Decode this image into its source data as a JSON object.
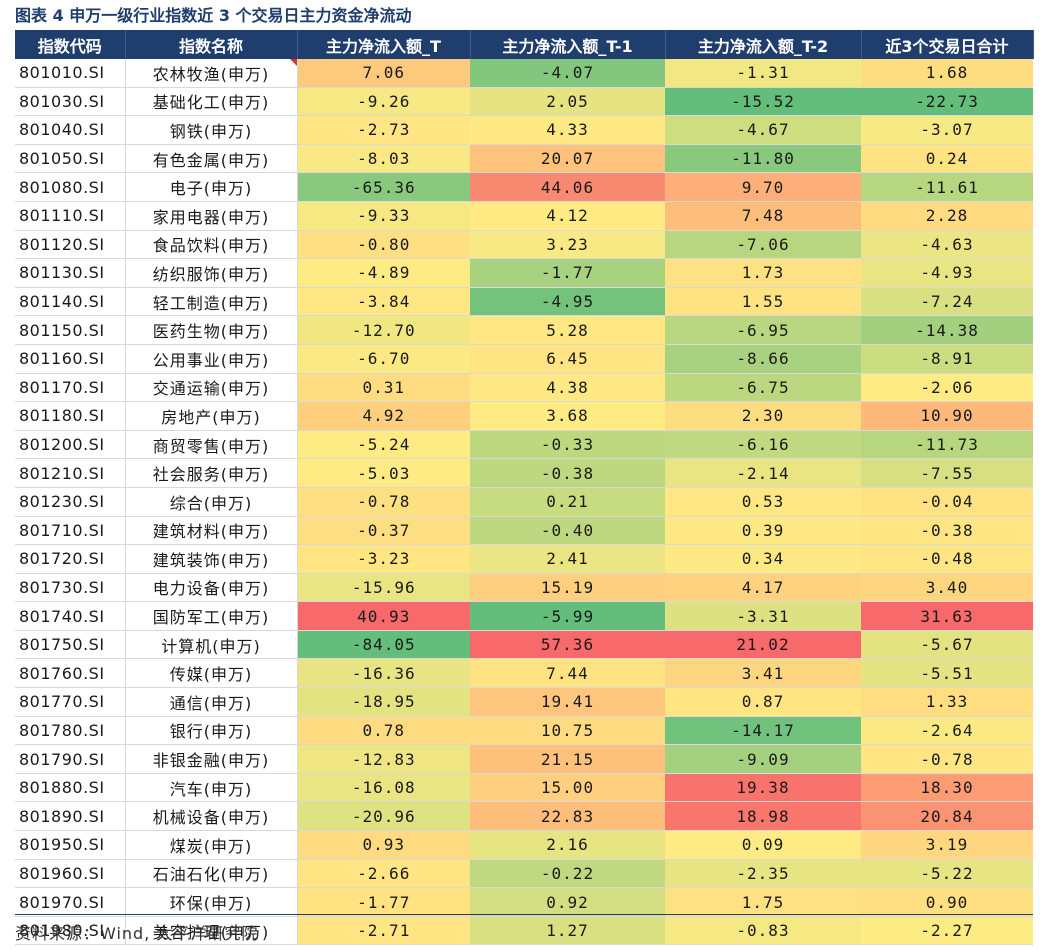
{
  "caption": "图表 4  申万一级行业指数近 3 个交易日主力资金净流动",
  "columns": [
    "指数代码",
    "指数名称",
    "主力净流入额_T",
    "主力净流入额_T-1",
    "主力净流入额_T-2",
    "近3个交易日合计"
  ],
  "rows": [
    {
      "code": "801010.SI",
      "name": "农林牧渔(申万)",
      "t": "7.06",
      "t1": "-4.07",
      "t2": "-1.31",
      "sum": "1.68"
    },
    {
      "code": "801030.SI",
      "name": "基础化工(申万)",
      "t": "-9.26",
      "t1": "2.05",
      "t2": "-15.52",
      "sum": "-22.73"
    },
    {
      "code": "801040.SI",
      "name": "钢铁(申万)",
      "t": "-2.73",
      "t1": "4.33",
      "t2": "-4.67",
      "sum": "-3.07"
    },
    {
      "code": "801050.SI",
      "name": "有色金属(申万)",
      "t": "-8.03",
      "t1": "20.07",
      "t2": "-11.80",
      "sum": "0.24"
    },
    {
      "code": "801080.SI",
      "name": "电子(申万)",
      "t": "-65.36",
      "t1": "44.06",
      "t2": "9.70",
      "sum": "-11.61"
    },
    {
      "code": "801110.SI",
      "name": "家用电器(申万)",
      "t": "-9.33",
      "t1": "4.12",
      "t2": "7.48",
      "sum": "2.28"
    },
    {
      "code": "801120.SI",
      "name": "食品饮料(申万)",
      "t": "-0.80",
      "t1": "3.23",
      "t2": "-7.06",
      "sum": "-4.63"
    },
    {
      "code": "801130.SI",
      "name": "纺织服饰(申万)",
      "t": "-4.89",
      "t1": "-1.77",
      "t2": "1.73",
      "sum": "-4.93"
    },
    {
      "code": "801140.SI",
      "name": "轻工制造(申万)",
      "t": "-3.84",
      "t1": "-4.95",
      "t2": "1.55",
      "sum": "-7.24"
    },
    {
      "code": "801150.SI",
      "name": "医药生物(申万)",
      "t": "-12.70",
      "t1": "5.28",
      "t2": "-6.95",
      "sum": "-14.38"
    },
    {
      "code": "801160.SI",
      "name": "公用事业(申万)",
      "t": "-6.70",
      "t1": "6.45",
      "t2": "-8.66",
      "sum": "-8.91"
    },
    {
      "code": "801170.SI",
      "name": "交通运输(申万)",
      "t": "0.31",
      "t1": "4.38",
      "t2": "-6.75",
      "sum": "-2.06"
    },
    {
      "code": "801180.SI",
      "name": "房地产(申万)",
      "t": "4.92",
      "t1": "3.68",
      "t2": "2.30",
      "sum": "10.90"
    },
    {
      "code": "801200.SI",
      "name": "商贸零售(申万)",
      "t": "-5.24",
      "t1": "-0.33",
      "t2": "-6.16",
      "sum": "-11.73"
    },
    {
      "code": "801210.SI",
      "name": "社会服务(申万)",
      "t": "-5.03",
      "t1": "-0.38",
      "t2": "-2.14",
      "sum": "-7.55"
    },
    {
      "code": "801230.SI",
      "name": "综合(申万)",
      "t": "-0.78",
      "t1": "0.21",
      "t2": "0.53",
      "sum": "-0.04"
    },
    {
      "code": "801710.SI",
      "name": "建筑材料(申万)",
      "t": "-0.37",
      "t1": "-0.40",
      "t2": "0.39",
      "sum": "-0.38"
    },
    {
      "code": "801720.SI",
      "name": "建筑装饰(申万)",
      "t": "-3.23",
      "t1": "2.41",
      "t2": "0.34",
      "sum": "-0.48"
    },
    {
      "code": "801730.SI",
      "name": "电力设备(申万)",
      "t": "-15.96",
      "t1": "15.19",
      "t2": "4.17",
      "sum": "3.40"
    },
    {
      "code": "801740.SI",
      "name": "国防军工(申万)",
      "t": "40.93",
      "t1": "-5.99",
      "t2": "-3.31",
      "sum": "31.63"
    },
    {
      "code": "801750.SI",
      "name": "计算机(申万)",
      "t": "-84.05",
      "t1": "57.36",
      "t2": "21.02",
      "sum": "-5.67"
    },
    {
      "code": "801760.SI",
      "name": "传媒(申万)",
      "t": "-16.36",
      "t1": "7.44",
      "t2": "3.41",
      "sum": "-5.51"
    },
    {
      "code": "801770.SI",
      "name": "通信(申万)",
      "t": "-18.95",
      "t1": "19.41",
      "t2": "0.87",
      "sum": "1.33"
    },
    {
      "code": "801780.SI",
      "name": "银行(申万)",
      "t": "0.78",
      "t1": "10.75",
      "t2": "-14.17",
      "sum": "-2.64"
    },
    {
      "code": "801790.SI",
      "name": "非银金融(申万)",
      "t": "-12.83",
      "t1": "21.15",
      "t2": "-9.09",
      "sum": "-0.78"
    },
    {
      "code": "801880.SI",
      "name": "汽车(申万)",
      "t": "-16.08",
      "t1": "15.00",
      "t2": "19.38",
      "sum": "18.30"
    },
    {
      "code": "801890.SI",
      "name": "机械设备(申万)",
      "t": "-20.96",
      "t1": "22.83",
      "t2": "18.98",
      "sum": "20.84"
    },
    {
      "code": "801950.SI",
      "name": "煤炭(申万)",
      "t": "0.93",
      "t1": "2.16",
      "t2": "0.09",
      "sum": "3.19"
    },
    {
      "code": "801960.SI",
      "name": "石油石化(申万)",
      "t": "-2.66",
      "t1": "-0.22",
      "t2": "-2.35",
      "sum": "-5.22"
    },
    {
      "code": "801970.SI",
      "name": "环保(申万)",
      "t": "-1.77",
      "t1": "0.92",
      "t2": "1.75",
      "sum": "0.90"
    },
    {
      "code": "801980.SI",
      "name": "美容护理(申万)",
      "t": "-2.71",
      "t1": "1.27",
      "t2": "-0.83",
      "sum": "-2.27"
    }
  ],
  "heatmap_colors": {
    "negative": "#63be7b",
    "middle": "#ffeb84",
    "positive": "#f8696b"
  },
  "source": "资料来源：Wind, 太平洋研究院"
}
